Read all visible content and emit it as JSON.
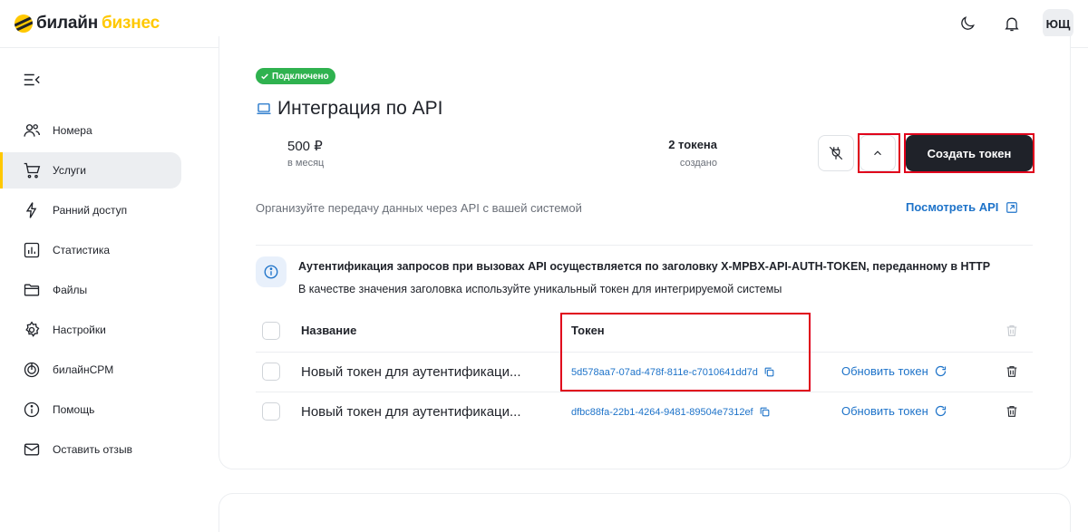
{
  "header": {
    "logo_part1": "билайн",
    "logo_part2": "бизнес",
    "avatar_initials": "ЮЩ"
  },
  "sidebar": {
    "items": [
      {
        "label": "Номера",
        "icon": "users-icon"
      },
      {
        "label": "Услуги",
        "icon": "cart-icon",
        "active": true
      },
      {
        "label": "Ранний доступ",
        "icon": "lightning-icon"
      },
      {
        "label": "Статистика",
        "icon": "stats-icon"
      },
      {
        "label": "Файлы",
        "icon": "folder-icon"
      },
      {
        "label": "Настройки",
        "icon": "gear-icon"
      },
      {
        "label": "билайнCPM",
        "icon": "crm-icon"
      },
      {
        "label": "Помощь",
        "icon": "info-icon"
      },
      {
        "label": "Оставить отзыв",
        "icon": "mail-icon"
      }
    ]
  },
  "service": {
    "status_badge": "Подключено",
    "title": "Интеграция по API",
    "price": "500 ₽",
    "price_period": "в месяц",
    "tokens_count": "2 токена",
    "tokens_caption": "создано",
    "create_button": "Создать токен",
    "description": "Организуйте передачу данных через API с вашей системой",
    "view_api_link": "Посмотреть API",
    "info_line1": "Аутентификация запросов при вызовах API осуществляется по заголовку X-MPBX-API-AUTH-TOKEN, переданному в HTTP",
    "info_line2": "В качестве значения заголовка используйте уникальный токен для интегрируемой системы"
  },
  "table": {
    "col_name": "Название",
    "col_token": "Токен",
    "rows": [
      {
        "name": "Новый токен для аутентификаци...",
        "token": "5d578aa7-07ad-478f-811e-c7010641dd7d",
        "refresh": "Обновить токен"
      },
      {
        "name": "Новый токен для аутентификаци...",
        "token": "dfbc88fa-22b1-4264-9481-89504e7312ef",
        "refresh": "Обновить токен"
      }
    ]
  },
  "colors": {
    "brand_yellow": "#ffc800",
    "success_green": "#2fb24f",
    "link_blue": "#1e73c9",
    "highlight_red": "#e0001b"
  }
}
